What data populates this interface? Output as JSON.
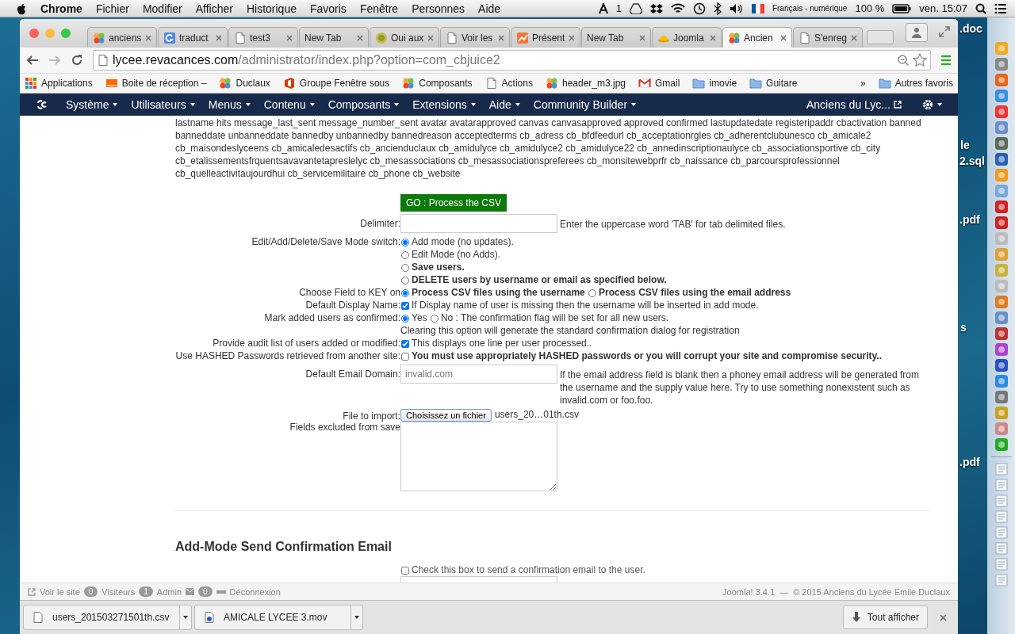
{
  "menubar": {
    "app": "Chrome",
    "menus": [
      "Fichier",
      "Modifier",
      "Afficher",
      "Historique",
      "Favoris",
      "Fenêtre",
      "Personnes",
      "Aide"
    ],
    "status": {
      "count": "1",
      "input_source": "Français - numérique",
      "battery": "100 %",
      "clock": "ven. 15:07"
    }
  },
  "desktop_labels": [
    ".doc",
    "le",
    "2.sql",
    ".pdf",
    "s",
    ".pdf"
  ],
  "tabs": [
    {
      "title": "anciens",
      "kind": "swirl",
      "selected": false
    },
    {
      "title": "traduct",
      "kind": "tile",
      "selected": false
    },
    {
      "title": "test3",
      "kind": "page",
      "selected": false
    },
    {
      "title": "New Tab",
      "kind": "blank",
      "selected": false
    },
    {
      "title": "Oui aux",
      "kind": "sun",
      "selected": false
    },
    {
      "title": "Voir les",
      "kind": "page",
      "selected": false
    },
    {
      "title": "Présent",
      "kind": "chart",
      "selected": false
    },
    {
      "title": "New Tab",
      "kind": "blank",
      "selected": false
    },
    {
      "title": "Joomla",
      "kind": "hat",
      "selected": false
    },
    {
      "title": "Ancien",
      "kind": "swirl",
      "selected": true
    },
    {
      "title": "S'enreg",
      "kind": "page",
      "selected": false
    }
  ],
  "address_bar": {
    "domain": "lycee.revacances.com",
    "path": "/administrator/index.php?option=com_cbjuice2"
  },
  "bookmarks": [
    {
      "label": "Applications",
      "kind": "grid"
    },
    {
      "label": "Boite de réception –",
      "kind": "orange"
    },
    {
      "label": "Duclaux",
      "kind": "swirl"
    },
    {
      "label": "Groupe Fenêtre sous",
      "kind": "office"
    },
    {
      "label": "Composants",
      "kind": "swirl"
    },
    {
      "label": "Actions",
      "kind": "page"
    },
    {
      "label": "header_m3.jpg",
      "kind": "swirl"
    },
    {
      "label": "Gmail",
      "kind": "mail"
    },
    {
      "label": "imovie",
      "kind": "folder"
    },
    {
      "label": "Guitare",
      "kind": "folder"
    }
  ],
  "bookmarks_more": "»",
  "other_bookmarks": "Autres favoris",
  "admin_menu": {
    "items": [
      "Système",
      "Utilisateurs",
      "Menus",
      "Contenu",
      "Composants",
      "Extensions",
      "Aide",
      "Community Builder"
    ],
    "site_link": "Anciens du Lyc..."
  },
  "field_list": "lastname hits message_last_sent message_number_sent avatar avatarapproved canvas canvasapproved approved confirmed lastupdatedate registeripaddr cbactivation banned banneddate unbanneddate bannedby unbannedby bannedreason acceptedterms cb_adress cb_bfdfeedurl cb_acceptationrgles cb_adherentclubunesco cb_amicale2 cb_maisondeslyceens cb_amicaledesactifs cb_ancienduclaux cb_amidulyce cb_amidulyce2 cb_amidulyce22 cb_annedinscriptionaulyce cb_associationsportive cb_city cb_etalissementsfrquentsavavantetapreslelyc cb_mesassociations cb_mesassociationspreferees cb_monsitewebprfr cb_naissance cb_parcoursprofessionnel cb_quelleactivitaujourdhui cb_servicemilitaire cb_phone cb_website",
  "form": {
    "rows": [
      {
        "kind": "button",
        "text": "GO : Process the CSV"
      },
      {
        "kind": "text_input",
        "label": "Delimiter:",
        "hint": "Enter the uppercase word 'TAB' for tab delimited files."
      },
      {
        "kind": "radio_stack",
        "label": "Edit/Add/Delete/Save Mode switch:",
        "options": [
          {
            "text": "Add mode (no updates).",
            "strong": false,
            "selected": true
          },
          {
            "text": "Edit Mode (no Adds).",
            "strong": false,
            "selected": false
          },
          {
            "text": "Save users.",
            "strong": true,
            "selected": false
          },
          {
            "text": "DELETE users by username or email as specified below.",
            "strong": true,
            "selected": false
          }
        ]
      },
      {
        "kind": "radio_inline",
        "label": "Choose Field to KEY on",
        "options": [
          {
            "text": "Process CSV files using the username",
            "strong": true,
            "selected": true
          },
          {
            "text": "Process CSV files using the email address",
            "strong": true,
            "selected": false
          }
        ]
      },
      {
        "kind": "checkbox",
        "label": "Default Display Name:",
        "checked": true,
        "strong": false,
        "text": "If Display name of user is missing then the username will be inserted in add mode."
      },
      {
        "kind": "radio_inline",
        "label": "Mark added users as confirmed:",
        "options": [
          {
            "text": "Yes",
            "strong": false,
            "selected": true
          },
          {
            "text": "No : The confirmation flag will be set for all new users.",
            "strong": false,
            "selected": false
          }
        ],
        "note": "Clearing this option will generate the standard confirmation dialog for registration"
      },
      {
        "kind": "checkbox",
        "label": "Provide audit list of users added or modified:",
        "checked": true,
        "strong": false,
        "text": "This displays one line per user processed.."
      },
      {
        "kind": "checkbox",
        "label": "Use HASHED Passwords retrieved from another site:",
        "checked": false,
        "strong": true,
        "text": "You must use appropriately HASHED passwords or you will corrupt your site and compromise security.."
      },
      {
        "kind": "text_input",
        "label": "Default Email Domain:",
        "value": "invalid.com",
        "hint": "If the email address field is blank then a phoney email address will be generated from the username and the supply value here. Try to use something nonexistent such as invalid.com or foo.foo."
      },
      {
        "kind": "file",
        "label": "File to import:",
        "button": "Choisissez un fichier",
        "file_name": "users_20…01th.csv"
      },
      {
        "kind": "textarea",
        "label": "Fields excluded from save"
      }
    ]
  },
  "confirmation_section": {
    "heading": "Add-Mode Send Confirmation Email",
    "checked": false,
    "text": "Check this box to send a confirmation email to the user."
  },
  "status_bar": {
    "view_site": "Voir le site",
    "visitors": {
      "count": "0",
      "label": "Visiteurs"
    },
    "admins": {
      "count": "1",
      "label": "Admin"
    },
    "messages": {
      "count": "0"
    },
    "logout": "Déconnexion",
    "version": "Joomla! 3.4.1",
    "separator": "—",
    "copyright": "© 2015 Anciens du Lycée Emile Duclaux"
  },
  "downloads": {
    "items": [
      {
        "name": "users_201503271501th.csv",
        "kind": "file"
      },
      {
        "name": "AMICALE LYCEE 3.mov",
        "kind": "movie"
      }
    ],
    "show_all": "Tout afficher"
  }
}
